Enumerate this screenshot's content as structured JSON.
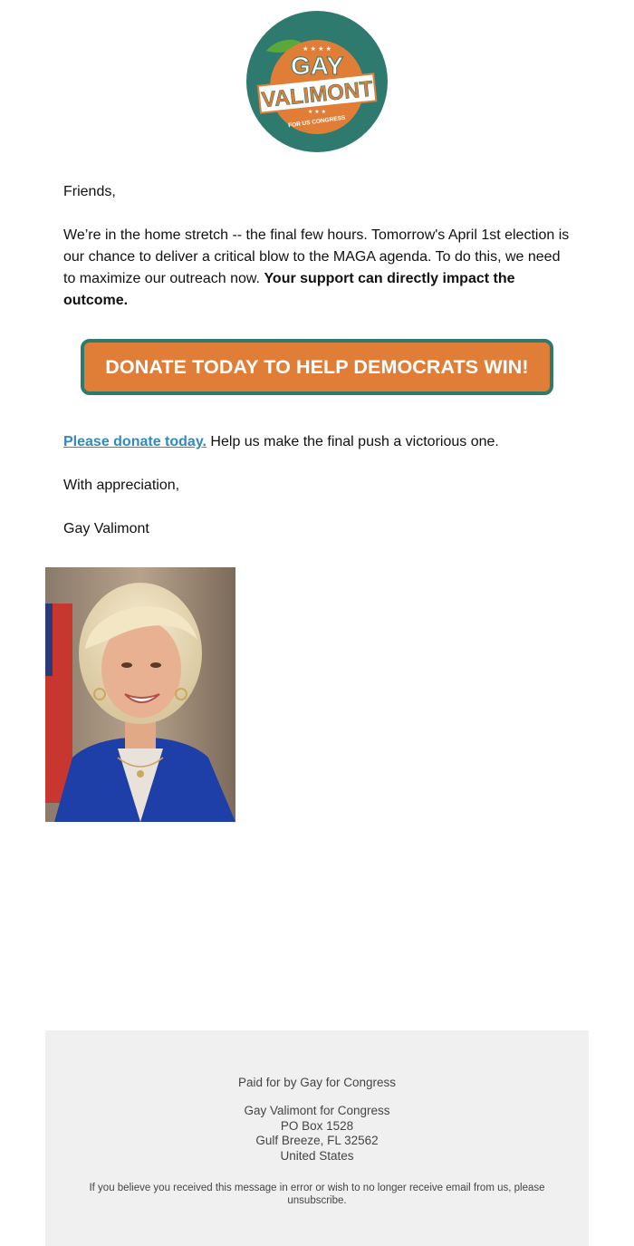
{
  "logo": {
    "name_line1": "GAY",
    "name_line2": "VALIMONT",
    "tagline": "FOR US CONGRESS",
    "colors": {
      "circle": "#2e7a6f",
      "badge": "#e07e38",
      "leaf": "#5aa83a",
      "ribbon": "#ffffff"
    }
  },
  "email": {
    "greeting": "Friends,",
    "intro_text": "We’re in the home stretch -- the final few hours. Tomorrow's April 1st election is our chance to deliver a critical blow to the MAGA agenda. To do this, we need to maximize our outreach now. ",
    "intro_bold": "Your support can directly impact the outcome.",
    "cta_label": "DONATE TODAY TO HELP DEMOCRATS WIN!",
    "donate_link": "Please donate today.",
    "donate_rest": " Help us make the final push a victorious one.",
    "closing": "With appreciation,",
    "signature": "Gay Valimont",
    "photo_name": "candidate-portrait"
  },
  "footer": {
    "paid_for": "Paid for by Gay for Congress",
    "address": [
      "Gay Valimont for Congress",
      "PO Box 1528",
      "Gulf Breeze, FL 32562",
      "United States"
    ],
    "disclaimer_text": "If you believe you received this message in error or wish to no longer receive email from us, please ",
    "unsubscribe": "unsubscribe",
    "disclaimer_end": "."
  },
  "colors": {
    "cta_bg": "#e07e38",
    "cta_border": "#2e7a6f",
    "link": "#2e8ac0",
    "footer_bg": "#f0f0f0"
  }
}
